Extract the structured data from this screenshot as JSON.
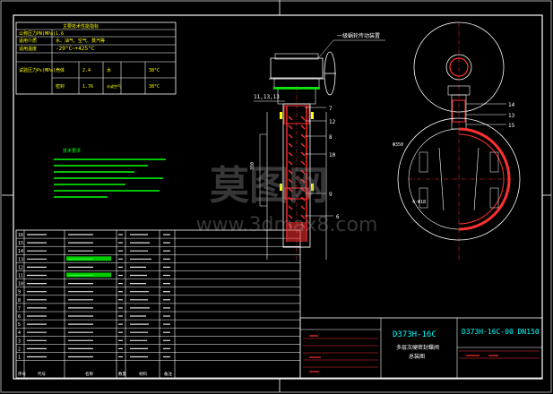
{
  "tech_table": {
    "title": "主要技术性能指标",
    "rows": [
      {
        "label": "公称压力PN(MPa)",
        "value": "1.6"
      },
      {
        "label": "适用介质",
        "value": "水、油气、空气、蒸汽等"
      },
      {
        "label": "适用温度",
        "value": "-29°C~+425°C"
      }
    ],
    "test_label": "试验压力Ps(MPa)",
    "tests": [
      {
        "kind": "壳体",
        "pressure": "2.4",
        "medium": "水",
        "temp": "38°C"
      },
      {
        "kind": "密封",
        "pressure": "1.76",
        "medium": "水或空气",
        "temp": "38°C"
      }
    ]
  },
  "notes_title": "技术要求",
  "drawing": {
    "callout": "一级蜗轮传动装置",
    "leader_labels": [
      "11,13,13",
      "7",
      "12",
      "8",
      "10",
      "9",
      "6"
    ],
    "right_labels": [
      "14",
      "13",
      "15"
    ],
    "dims": [
      "350",
      "Φ350",
      "4-Φ18"
    ]
  },
  "parts": {
    "rows": [
      {
        "no": "16"
      },
      {
        "no": "15"
      },
      {
        "no": "14"
      },
      {
        "no": "13"
      },
      {
        "no": "12"
      },
      {
        "no": "11"
      },
      {
        "no": "10"
      },
      {
        "no": "9"
      },
      {
        "no": "8"
      },
      {
        "no": "7"
      },
      {
        "no": "6"
      },
      {
        "no": "5"
      },
      {
        "no": "4"
      },
      {
        "no": "3"
      },
      {
        "no": "2"
      },
      {
        "no": "1"
      }
    ],
    "header": [
      "序号",
      "代号",
      "名称",
      "数量",
      "材料",
      "备注"
    ]
  },
  "title_block": {
    "model": "D373H-16C",
    "name_line1": "多层次硬密封蝶阀",
    "name_line2": "总装图",
    "drawing_no": "D373H-16C-00 DN150"
  },
  "watermark": {
    "cn": "莫图网",
    "url": "www.3dmax8.com"
  },
  "colors": {
    "frame": "#ffffff",
    "table_text": "#ffff00",
    "drawing": "#ffffff",
    "cyan": "#00ffff",
    "green": "#00ff00",
    "red": "#ff3030",
    "magenta": "#ff40ff"
  }
}
